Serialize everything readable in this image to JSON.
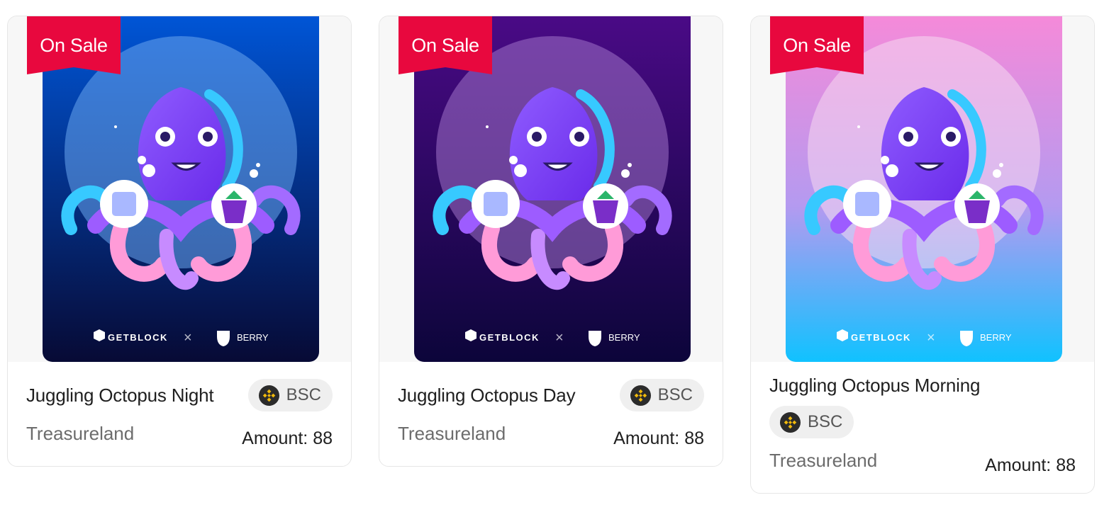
{
  "cards": [
    {
      "badge": "On Sale",
      "title": "Juggling Octopus Night",
      "chain": "BSC",
      "creator": "Treasureland",
      "amount": "Amount: 88",
      "art": {
        "bg_top": "#0055d6",
        "bg_bottom": "#070a35",
        "halo": "#6aa6ee",
        "logo_left": "GETBLOCK",
        "logo_right": "BERRY"
      }
    },
    {
      "badge": "On Sale",
      "title": "Juggling Octopus Day",
      "chain": "BSC",
      "creator": "Treasureland",
      "amount": "Amount: 88",
      "art": {
        "bg_top": "#4a0a86",
        "bg_bottom": "#0c053a",
        "halo": "#a073c9",
        "logo_left": "GETBLOCK",
        "logo_right": "BERRY"
      }
    },
    {
      "badge": "On Sale",
      "title": "Juggling Octopus Morning",
      "chain": "BSC",
      "creator": "Treasureland",
      "amount": "Amount: 88",
      "art": {
        "bg_top": "#f58ad9",
        "bg_bottom": "#10c2ff",
        "halo": "#f6d9f0",
        "logo_left": "GETBLOCK",
        "logo_right": "BERRY"
      }
    }
  ],
  "colors": {
    "badge": "#e8083e",
    "chain_badge_bg": "#efefef",
    "bnb": "#f0b90b"
  }
}
